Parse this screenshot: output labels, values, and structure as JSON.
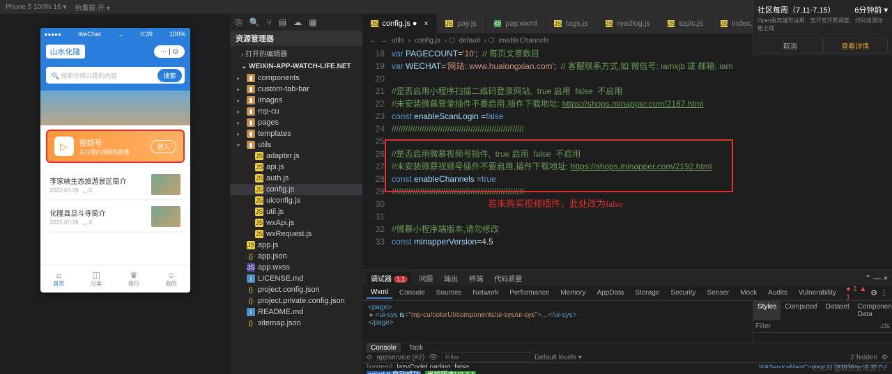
{
  "topbar": {
    "device": "Phone 5 100% 16 ▾",
    "hot": "热重载 开 ▾"
  },
  "notif": {
    "title": "社区每周（7.11-7.15）",
    "time": "6分钟前 ▾",
    "body": "Open服务端可设用、支开支开费调整、代码加测动能上线",
    "btn1": "取消",
    "btn2": "查看详情"
  },
  "simulator": {
    "status": {
      "sig": "●●●●●",
      "carrier": "WeChat",
      "wifi": "⌄",
      "time": "0:39",
      "bat": "100%"
    },
    "apptitle": "山水化隆",
    "search": {
      "placeholder": "🔍 搜索你感兴趣的内容",
      "btn": "搜索"
    },
    "video": {
      "title": "视频号",
      "sub": "关注我的视频和直播",
      "btn": "进入"
    },
    "list": [
      {
        "title": "李家峡生态旅游景区简介",
        "date": "2022-07-29",
        "v": "◡ 0"
      },
      {
        "title": "化隆县旦斗寺简介",
        "date": "2022-07-29",
        "v": "◡ 0"
      }
    ],
    "tabs": [
      {
        "ic": "⌂",
        "label": "首页"
      },
      {
        "ic": "◫",
        "label": "分类"
      },
      {
        "ic": "♛",
        "label": "排行"
      },
      {
        "ic": "☺",
        "label": "我的"
      }
    ]
  },
  "explorer": {
    "section": "资源管理器",
    "sub1": "› 打开的编辑器",
    "root": "⌄ WEIXIN-APP-WATCH-LIFE.NET",
    "items": [
      {
        "t": "folder",
        "n": "components"
      },
      {
        "t": "folder",
        "n": "custom-tab-bar"
      },
      {
        "t": "folder",
        "n": "images"
      },
      {
        "t": "folder",
        "n": "mp-cu"
      },
      {
        "t": "folder",
        "n": "pages"
      },
      {
        "t": "folder",
        "n": "templates"
      },
      {
        "t": "folder",
        "n": "utils",
        "open": true
      },
      {
        "t": "js",
        "n": "adapter.js",
        "lvl": 1
      },
      {
        "t": "js",
        "n": "api.js",
        "lvl": 1
      },
      {
        "t": "js",
        "n": "auth.js",
        "lvl": 1
      },
      {
        "t": "js",
        "n": "config.js",
        "lvl": 1,
        "active": true
      },
      {
        "t": "js",
        "n": "uiconfig.js",
        "lvl": 1
      },
      {
        "t": "js",
        "n": "util.js",
        "lvl": 1
      },
      {
        "t": "js",
        "n": "wxApi.js",
        "lvl": 1
      },
      {
        "t": "js",
        "n": "wxRequest.js",
        "lvl": 1
      },
      {
        "t": "js",
        "n": "app.js"
      },
      {
        "t": "json",
        "n": "app.json"
      },
      {
        "t": "wxss",
        "n": "app.wxss"
      },
      {
        "t": "md",
        "n": "LICENSE.md"
      },
      {
        "t": "json",
        "n": "project.config.json"
      },
      {
        "t": "json",
        "n": "project.private.config.json"
      },
      {
        "t": "md",
        "n": "README.md"
      },
      {
        "t": "json",
        "n": "sitemap.json"
      }
    ]
  },
  "tabs": [
    {
      "n": "config.js",
      "t": "js",
      "active": true,
      "mod": true
    },
    {
      "n": "pay.js",
      "t": "js"
    },
    {
      "n": "pay.wxml",
      "t": "wxml"
    },
    {
      "n": "tags.js",
      "t": "js"
    },
    {
      "n": "readlog.js",
      "t": "js"
    },
    {
      "n": "topic.js",
      "t": "js"
    },
    {
      "n": "index.js",
      "t": "js"
    }
  ],
  "breadcrumb": {
    "p1": "utils",
    "p2": "config.js",
    "p3": "default",
    "p4": "enableChannels"
  },
  "code": {
    "start": 18,
    "lines": [
      {
        "h": "<span class='k'>var</span> <span class='v'>PAGECOUNT</span>=<span class='s'>'10'</span>;  <span class='c'>// 每页文章数目</span>"
      },
      {
        "h": "<span class='k'>var</span> <span class='v'>WECHAT</span>=<span class='s'>'网站: www.hualongxian.com'</span>;  <span class='c'>// 客服联系方式,如 微信号: iamxjb 或 邮箱: iam</span>"
      },
      {
        "h": ""
      },
      {
        "h": "<span class='c'>//是否启用小程序扫描二维码登录网站,  true 启用  false  不启用</span>"
      },
      {
        "h": "<span class='c'>//未安装微慕登录插件不要启用,插件下载地址: <span class='u'>https://shops.minapper.com/2167.html</span></span>"
      },
      {
        "h": "<span class='k'>const</span> <span class='v'>enableScanLogin</span> =<span class='k'>false</span>"
      },
      {
        "h": "<span class='c'>/////////////////////////////////////////////////////////</span>"
      },
      {
        "h": ""
      },
      {
        "h": "<span class='c'>//是否启用微慕视频号插件,  true 启用  false  不启用</span>"
      },
      {
        "h": "<span class='c'>//未安装微慕视频号插件不要启用,插件下载地址: <span class='u'>https://shops.minapper.com/2192.html</span></span>"
      },
      {
        "h": "<span class='k'>const</span> <span class='v'>enableChannels</span> =<span class='k'>true</span>"
      },
      {
        "h": "<span class='c'>/////////////////////////////////////////////////////////</span>"
      },
      {
        "h": ""
      },
      {
        "h": ""
      },
      {
        "h": "<span class='c'>//微慕小程序端版本,请勿修改</span>"
      },
      {
        "h": "<span class='k'>const</span> <span class='v'>minapperVersion</span>=<span class='n'>4.5</span>"
      }
    ]
  },
  "redtext": "若未购买视频插件，此处改为false",
  "devtools": {
    "row1": [
      {
        "l": "调试器",
        "b": "1,1"
      },
      {
        "l": "问题"
      },
      {
        "l": "输出"
      },
      {
        "l": "终端"
      },
      {
        "l": "代码质量"
      }
    ],
    "row2": [
      "Wxml",
      "Console",
      "Sources",
      "Network",
      "Performance",
      "Memory",
      "AppData",
      "Storage",
      "Security",
      "Sensor",
      "Mock",
      "Audits",
      "Vulnerability"
    ],
    "errors": "● 1 ▲ 1",
    "wxml": "<page>\n ▸ <ui-sys is=\"mp-cu/colorUI/components/ui-sys/ui-sys\">…</ui-sys>\n</page>",
    "styles": {
      "tabs": [
        "Styles",
        "Computed",
        "Dataset",
        "Component Data"
      ],
      "filter": "Filter",
      "cls": ".cls"
    },
    "console": {
      "tabs": [
        "Console",
        "Task"
      ],
      "tool": {
        "scope": "appservice (#2)",
        "filter": "Filter",
        "level": "Default levels ▾",
        "hidden": "2 hidden"
      },
      "l1": {
        "sys": "[system]",
        "msg": "lazyCodeLoading: false",
        "right": "WAServiceMainContext.11793036&v=2.25.0:1"
      },
      "l2": {
        "t1": "colorUI 启动成功",
        "t2": "当前版本V3.3.1"
      }
    }
  },
  "watermark": "CSDN @欧的太沛透了c"
}
